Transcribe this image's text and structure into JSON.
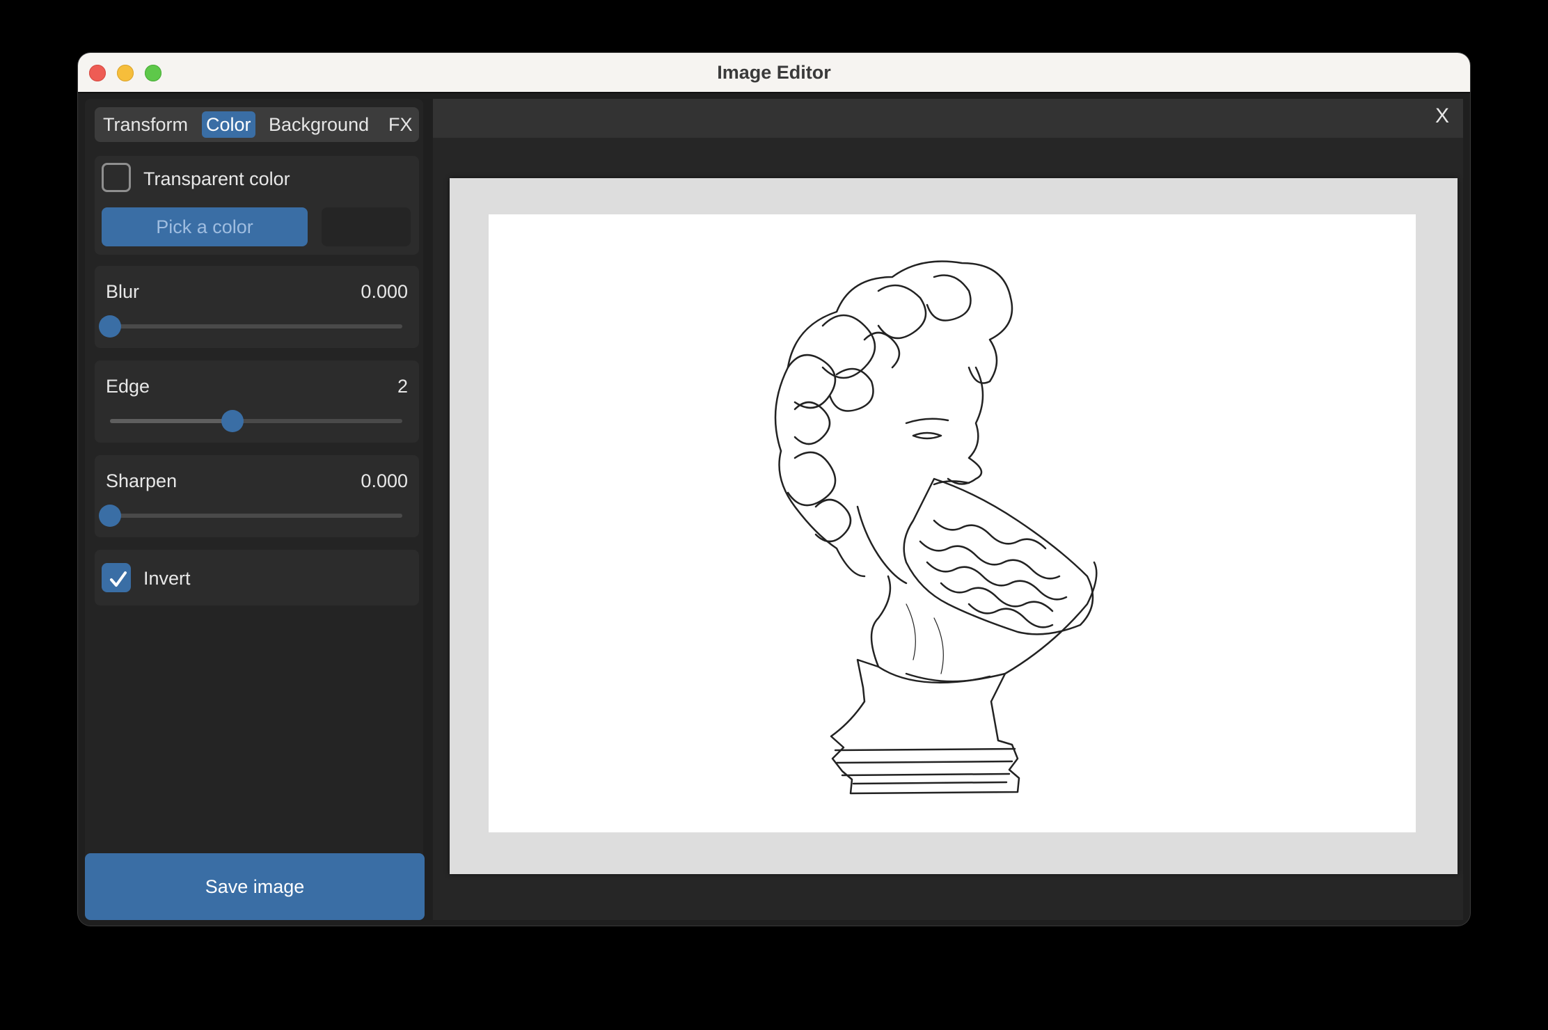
{
  "window": {
    "title": "Image Editor"
  },
  "tabs": [
    {
      "label": "Transform",
      "active": false
    },
    {
      "label": "Color",
      "active": true
    },
    {
      "label": "Background",
      "active": false
    },
    {
      "label": "FX",
      "active": false
    }
  ],
  "color_section": {
    "transparent_color": {
      "label": "Transparent color",
      "checked": false
    },
    "pick_color_label": "Pick a color"
  },
  "sliders": {
    "blur": {
      "label": "Blur",
      "value": "0.000",
      "fraction": 0.0
    },
    "edge": {
      "label": "Edge",
      "value": "2",
      "fraction": 0.42
    },
    "sharpen": {
      "label": "Sharpen",
      "value": "0.000",
      "fraction": 0.0
    }
  },
  "invert": {
    "label": "Invert",
    "checked": true
  },
  "save_button": "Save image",
  "canvas": {
    "close_label": "X"
  },
  "colors": {
    "accent": "#3a6ea5",
    "panel": "#242424",
    "card": "#2c2c2c"
  }
}
